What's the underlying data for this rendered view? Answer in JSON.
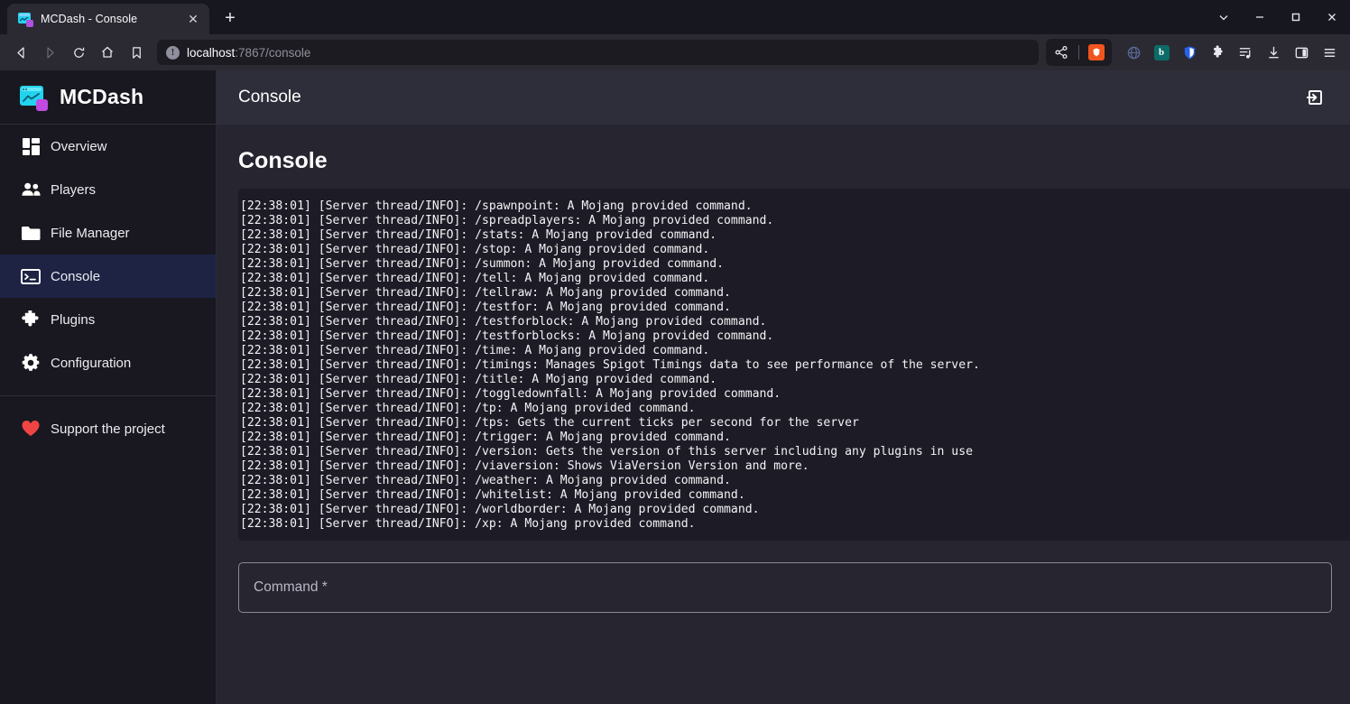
{
  "browser": {
    "tab": {
      "title": "MCDash - Console",
      "favicon": "mcdash-favicon",
      "close_label": "✕"
    },
    "newtab_label": "+",
    "window_controls": {
      "tabsearch": "tab-search-chevron",
      "minimize": "minimize",
      "maximize": "maximize",
      "close": "close"
    },
    "nav": {
      "back": "back-arrow",
      "forward": "forward-arrow",
      "reload": "reload",
      "home": "home",
      "bookmark": "bookmark"
    },
    "url": {
      "host": "localhost",
      "rest": ":7867/console",
      "security_icon": "info-circle-icon"
    },
    "toolbar_icons": [
      "share-icon",
      "brave-lion-icon",
      "vpn-globe-icon",
      "bitwarden-icon",
      "shield-icon",
      "extensions-puzzle-icon",
      "playlist-icon",
      "download-icon",
      "sidebar-panel-icon",
      "hamburger-menu-icon"
    ]
  },
  "app": {
    "brand": {
      "name": "MCDash",
      "logo": "mcdash-logo"
    },
    "sidebar": {
      "items": [
        {
          "label": "Overview",
          "icon": "dashboard-grid-icon",
          "active": false
        },
        {
          "label": "Players",
          "icon": "people-icon",
          "active": false
        },
        {
          "label": "File Manager",
          "icon": "folder-icon",
          "active": false
        },
        {
          "label": "Console",
          "icon": "terminal-icon",
          "active": true
        },
        {
          "label": "Plugins",
          "icon": "puzzle-icon",
          "active": false
        },
        {
          "label": "Configuration",
          "icon": "gear-icon",
          "active": false
        }
      ],
      "support": {
        "label": "Support the project",
        "icon": "heart-icon",
        "color": "#ef4444"
      }
    },
    "topbar": {
      "title": "Console",
      "logout_icon": "logout-icon"
    },
    "page": {
      "title": "Console",
      "console_lines": [
        "[22:38:01] [Server thread/INFO]: /spawnpoint: A Mojang provided command.",
        "[22:38:01] [Server thread/INFO]: /spreadplayers: A Mojang provided command.",
        "[22:38:01] [Server thread/INFO]: /stats: A Mojang provided command.",
        "[22:38:01] [Server thread/INFO]: /stop: A Mojang provided command.",
        "[22:38:01] [Server thread/INFO]: /summon: A Mojang provided command.",
        "[22:38:01] [Server thread/INFO]: /tell: A Mojang provided command.",
        "[22:38:01] [Server thread/INFO]: /tellraw: A Mojang provided command.",
        "[22:38:01] [Server thread/INFO]: /testfor: A Mojang provided command.",
        "[22:38:01] [Server thread/INFO]: /testforblock: A Mojang provided command.",
        "[22:38:01] [Server thread/INFO]: /testforblocks: A Mojang provided command.",
        "[22:38:01] [Server thread/INFO]: /time: A Mojang provided command.",
        "[22:38:01] [Server thread/INFO]: /timings: Manages Spigot Timings data to see performance of the server.",
        "[22:38:01] [Server thread/INFO]: /title: A Mojang provided command.",
        "[22:38:01] [Server thread/INFO]: /toggledownfall: A Mojang provided command.",
        "[22:38:01] [Server thread/INFO]: /tp: A Mojang provided command.",
        "[22:38:01] [Server thread/INFO]: /tps: Gets the current ticks per second for the server",
        "[22:38:01] [Server thread/INFO]: /trigger: A Mojang provided command.",
        "[22:38:01] [Server thread/INFO]: /version: Gets the version of this server including any plugins in use",
        "[22:38:01] [Server thread/INFO]: /viaversion: Shows ViaVersion Version and more.",
        "[22:38:01] [Server thread/INFO]: /weather: A Mojang provided command.",
        "[22:38:01] [Server thread/INFO]: /whitelist: A Mojang provided command.",
        "[22:38:01] [Server thread/INFO]: /worldborder: A Mojang provided command.",
        "[22:38:01] [Server thread/INFO]: /xp: A Mojang provided command."
      ],
      "command_input": {
        "placeholder": "Command *",
        "value": ""
      }
    }
  },
  "colors": {
    "sidebar_bg": "#191820",
    "active_item": "#1e2344",
    "topbar_bg": "#2e2d3a",
    "content_bg": "#262530",
    "console_bg": "#1d1c26",
    "accent_cyan": "#22d3ee",
    "accent_purple": "#c04ae0",
    "heart_red": "#ef4444",
    "brave_orange": "#f0551f"
  }
}
